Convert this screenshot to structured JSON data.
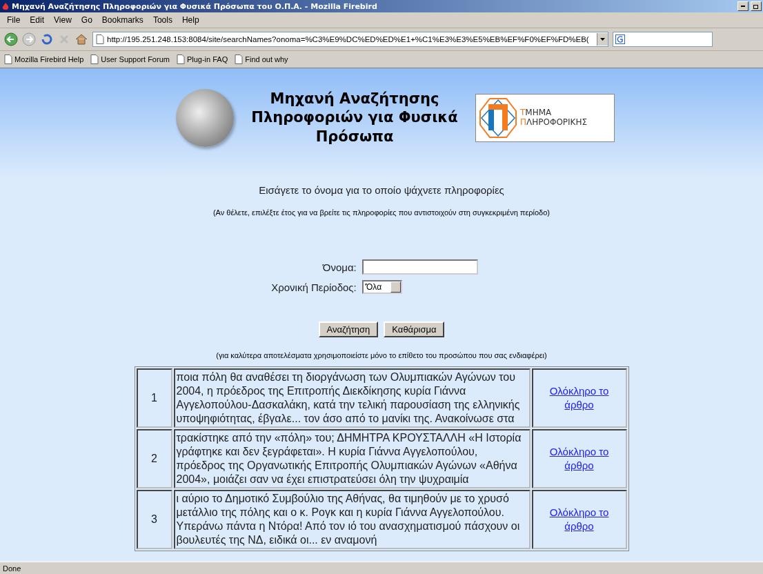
{
  "window": {
    "title": "Μηχανή Αναζήτησης Πληροφοριών για Φυσικά Πρόσωπα του Ο.Π.Α. - Mozilla Firebird"
  },
  "menu": [
    "File",
    "Edit",
    "View",
    "Go",
    "Bookmarks",
    "Tools",
    "Help"
  ],
  "address": {
    "url": "http://195.251.248.153:8084/site/searchNames?onoma=%C3%E9%DC%ED%ED%E1+%C1%E3%E3%E5%EB%EF%F0%EF%FD%EB("
  },
  "bookmarks": [
    "Mozilla Firebird Help",
    "User Support Forum",
    "Plug-in FAQ",
    "Find out why"
  ],
  "header": {
    "title": "Μηχανή Αναζήτησης Πληροφοριών για Φυσικά Πρόσωπα",
    "logo_lines": [
      "ΤΜΗΜΑ",
      "ΠΛΗΡΟΦΟΡΙΚΗΣ"
    ]
  },
  "intro": "Εισάγετε το όνομα για το οποίο ψάχνετε πληροφορίες",
  "note": "(Αν θέλετε, επιλέξτε έτος για να βρείτε τις πληροφορίες που αντιστοιχούν στη συγκεκριμένη περίοδο)",
  "form": {
    "name_label": "Όνομα:",
    "period_label": "Χρονική Περίοδος:",
    "period_value": "'Όλα",
    "buttons": [
      "Αναζήτηση",
      "Καθάρισμα"
    ]
  },
  "hint": "(για καλύτερα αποτελέσματα χρησιμοποιείστε μόνο το επίθετο του προσώπου που σας ενδιαφέρει)",
  "results": [
    {
      "number": "1",
      "snippet": "ποια πόλη θα αναθέσει τη διοργάνωση των Ολυμπιακών Αγώνων του 2004, η πρόεδρος της Επιτροπής Διεκδίκησης κυρία Γιάννα Αγγελοπούλου-Δασκαλάκη, κατά την τελική παρουσίαση της ελληνικής υποψηφιότητας, έβγαλε... τον άσο από το μανίκι της. Ανακοίνωσε στα",
      "link": "Ολόκληρο το άρθρο"
    },
    {
      "number": "2",
      "snippet": "τρακίστηκε από την «πόλη» του; ΔΗΜΗΤΡΑ ΚΡΟΥΣΤΑΛΛΗ «Η Ιστορία γράφτηκε και δεν ξεγράφεται». Η κυρία Γιάννα Αγγελοπούλου, πρόεδρος της Οργανωτικής Επιτροπής Ολυμπιακών Αγώνων «Αθήνα 2004», μοιάζει σαν να έχει επιστρατεύσει όλη την ψυχραιμία",
      "link": "Ολόκληρο το άρθρο"
    },
    {
      "number": "3",
      "snippet": "ι αύριο το Δημοτικό Συμβούλιο της Αθήνας, θα τιμηθούν με το χρυσό μετάλλιο της πόλης και ο κ. Ρογκ και η κυρία Γιάννα Αγγελοπούλου. Υπεράνω πάντα η Ντόρα! Από τον ιό του ανασχηματισμού πάσχουν οι βουλευτές της ΝΔ, ειδικά οι... εν αναμονή",
      "link": "Ολόκληρο το άρθρο"
    }
  ],
  "status_bar": {
    "text": "Done"
  }
}
